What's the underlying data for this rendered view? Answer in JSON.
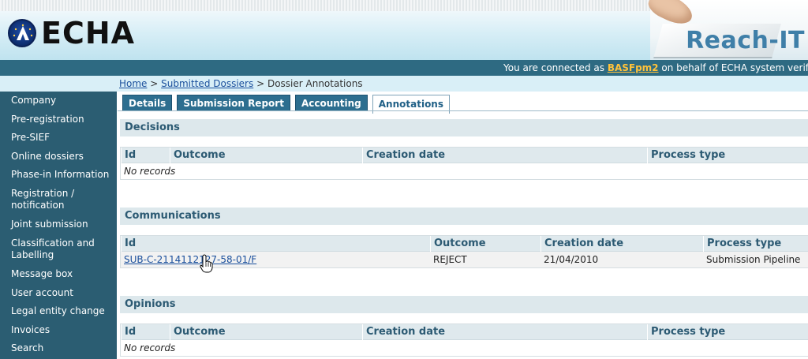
{
  "header": {
    "logo_text": "ECHA",
    "product_title": "Reach-IT"
  },
  "connection": {
    "prefix": "You are connected as",
    "user": "BASFpm2",
    "suffix": "on behalf of ECHA system verificatio"
  },
  "breadcrumb": {
    "home": "Home",
    "sep1": ">",
    "submitted": "Submitted Dossiers",
    "sep2": ">",
    "current": "Dossier Annotations"
  },
  "sidebar": {
    "items": [
      {
        "label": "Company"
      },
      {
        "label": "Pre-registration"
      },
      {
        "label": "Pre-SIEF"
      },
      {
        "label": "Online dossiers"
      },
      {
        "label": "Phase-in Information"
      },
      {
        "label": "Registration / notification"
      },
      {
        "label": "Joint submission"
      },
      {
        "label": "Classification and Labelling"
      },
      {
        "label": "Message box"
      },
      {
        "label": "User account"
      },
      {
        "label": "Legal entity change"
      },
      {
        "label": "Invoices"
      },
      {
        "label": "Search"
      }
    ]
  },
  "tabs": [
    {
      "label": "Details",
      "active": false
    },
    {
      "label": "Submission Report",
      "active": false
    },
    {
      "label": "Accounting",
      "active": false
    },
    {
      "label": "Annotations",
      "active": true
    }
  ],
  "decisions": {
    "title": "Decisions",
    "columns": [
      "Id",
      "Outcome",
      "Creation date",
      "Process type"
    ],
    "empty_text": "No records"
  },
  "communications": {
    "title": "Communications",
    "columns": [
      "Id",
      "Outcome",
      "Creation date",
      "Process type"
    ],
    "rows": [
      {
        "id": "SUB-C-2114112127-58-01/F",
        "outcome": "REJECT",
        "date": "21/04/2010",
        "process": "Submission Pipeline"
      }
    ]
  },
  "opinions": {
    "title": "Opinions",
    "columns": [
      "Id",
      "Outcome",
      "Creation date",
      "Process type"
    ],
    "empty_text": "No records"
  },
  "icons": {
    "logo": "echa-logo-icon",
    "cursor": "hand-cursor-icon"
  },
  "colors": {
    "sidebar_bg": "#2b5d72",
    "conn_bar_bg": "#2e6a82",
    "tab_bg": "#2d6e8f",
    "section_bg": "#dde8ec",
    "user_highlight": "#ffc23a"
  }
}
